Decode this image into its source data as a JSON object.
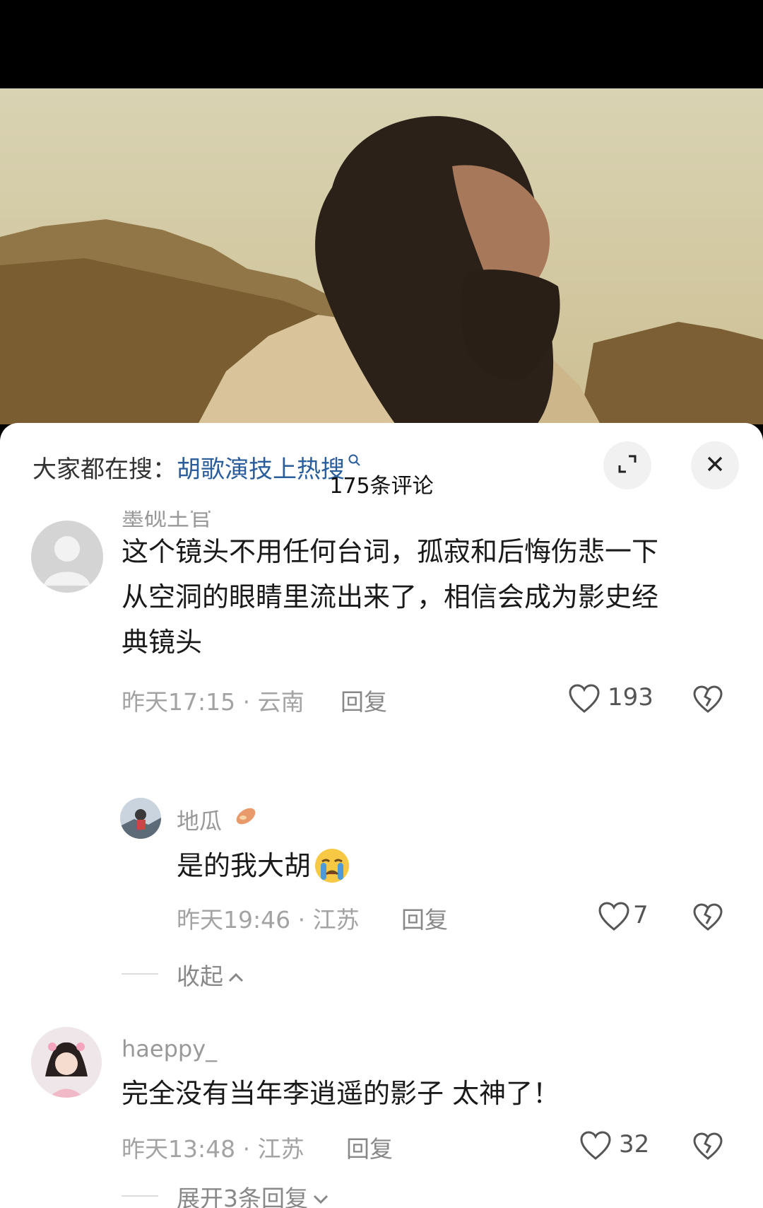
{
  "hot_search": {
    "prefix": "大家都在搜：",
    "term": "胡歌演技上热搜"
  },
  "comment_count": "175条评论",
  "comments": [
    {
      "username": "墨砚王官",
      "text_lines": [
        "这个镜头不用任何台词，孤寂和后悔伤悲一下",
        "从空洞的眼睛里流出来了，相信会成为影史经",
        "典镜头"
      ],
      "time": "昨天17:15 · 云南",
      "reply_label": "回复",
      "likes": "193"
    },
    {
      "username": "地瓜",
      "text": "是的我大胡",
      "time": "昨天19:46 · 江苏",
      "reply_label": "回复",
      "likes": "7"
    },
    {
      "username": "haeppy_",
      "text": "完全没有当年李逍遥的影子 太神了！",
      "time": "昨天13:48 · 江苏",
      "reply_label": "回复",
      "likes": "32"
    }
  ],
  "collapse_label": "收起",
  "expand_label": "展开3条回复",
  "colors": {
    "link": "#2a5d9c",
    "meta": "#a3a3a3"
  },
  "icons": [
    "search-icon",
    "expand-icon",
    "close-icon",
    "heart-icon",
    "dislike-icon",
    "chevron-up-icon",
    "chevron-down-icon"
  ]
}
